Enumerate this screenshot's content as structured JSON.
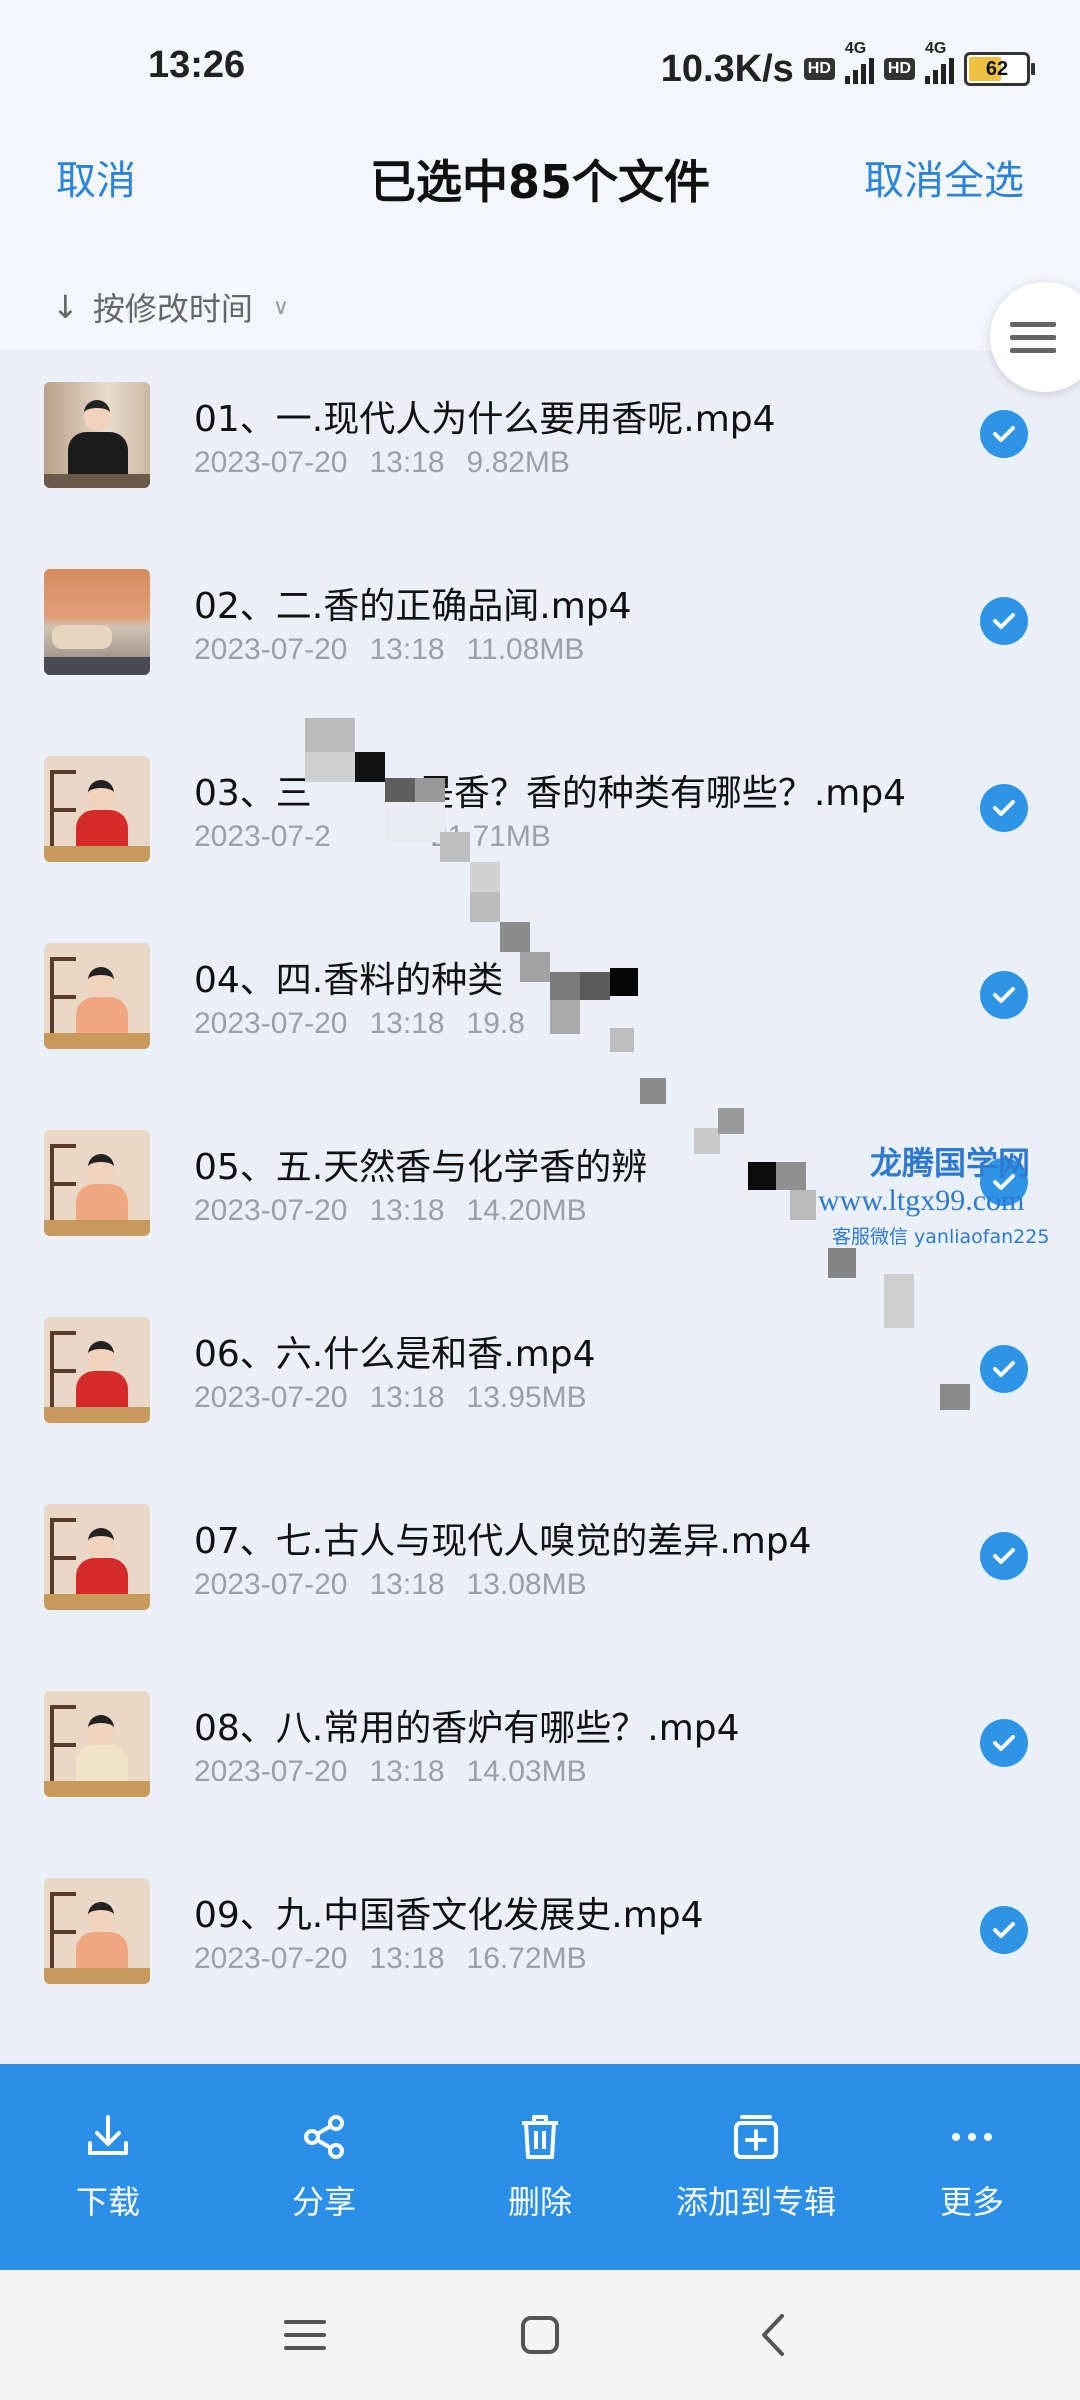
{
  "status": {
    "time": "13:26",
    "speed": "10.3K/s",
    "hd1": "HD",
    "hd2": "HD",
    "sig1": "4G",
    "sig2": "4G",
    "battery": "62"
  },
  "header": {
    "cancel": "取消",
    "title": "已选中85个文件",
    "deselect_all": "取消全选"
  },
  "sort": {
    "label": "按修改时间"
  },
  "files": [
    {
      "name": "01、一.现代人为什么要用香呢.mp4",
      "date": "2023-07-20",
      "time": "13:18",
      "size": "9.82MB",
      "thumb": "man"
    },
    {
      "name": "02、二.香的正确品闻.mp4",
      "date": "2023-07-20",
      "time": "13:18",
      "size": "11.08MB",
      "thumb": "cloth"
    },
    {
      "name": "03、三",
      "name_tail": "是香？香的种类有哪些？.mp4",
      "date": "2023-07-2",
      "time": "",
      "size": "21.71MB",
      "thumb": "red"
    },
    {
      "name": "04、四.香料的种类",
      "date": "2023-07-20",
      "time": "13:18",
      "size": "19.8",
      "thumb": "peach"
    },
    {
      "name": "05、五.天然香与化学香的辨",
      "date": "2023-07-20",
      "time": "13:18",
      "size": "14.20MB",
      "thumb": "peach"
    },
    {
      "name": "06、六.什么是和香.mp4",
      "date": "2023-07-20",
      "time": "13:18",
      "size": "13.95MB",
      "thumb": "red"
    },
    {
      "name": "07、七.古人与现代人嗅觉的差异.mp4",
      "date": "2023-07-20",
      "time": "13:18",
      "size": "13.08MB",
      "thumb": "red"
    },
    {
      "name": "08、八.常用的香炉有哪些？.mp4",
      "date": "2023-07-20",
      "time": "13:18",
      "size": "14.03MB",
      "thumb": "cream"
    },
    {
      "name": "09、九.中国香文化发展史.mp4",
      "date": "2023-07-20",
      "time": "13:18",
      "size": "16.72MB",
      "thumb": "peach"
    }
  ],
  "watermark": {
    "name": "龙腾国学网",
    "url": "www.ltgx99.com",
    "wechat": "客服微信 yanliaofan225"
  },
  "toolbar": {
    "download": "下载",
    "share": "分享",
    "delete": "删除",
    "add_album": "添加到专辑",
    "more": "更多"
  },
  "colors": {
    "accent": "#2b84d8",
    "toolbar": "#2b8fe8",
    "check": "#2e95e6"
  }
}
